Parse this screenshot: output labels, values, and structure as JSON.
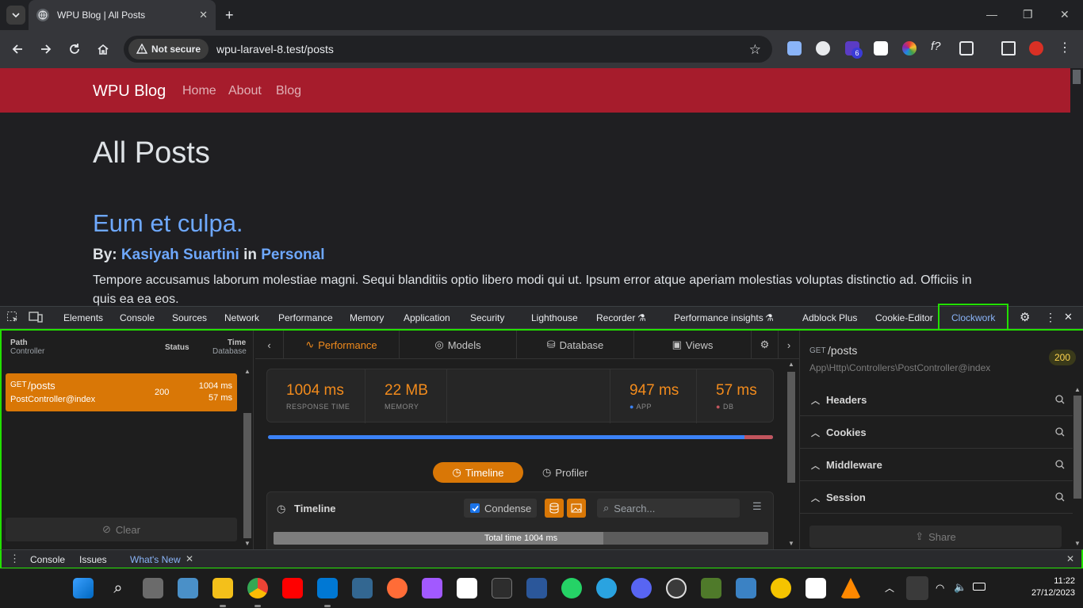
{
  "browser": {
    "tab_title": "WPU Blog | All Posts",
    "tab_close": "✕",
    "new_tab": "+",
    "not_secure": "Not secure",
    "url": "wpu-laravel-8.test/posts",
    "extension_badge": "6"
  },
  "site": {
    "brand": "WPU Blog",
    "nav": [
      "Home",
      "About",
      "Blog"
    ],
    "heading": "All Posts",
    "post": {
      "title": "Eum et culpa.",
      "by": "By:",
      "author": "Kasiyah Suartini",
      "in": "in",
      "category": "Personal",
      "excerpt": "Tempore accusamus laborum molestiae magni. Sequi blanditiis optio libero modi qui ut. Ipsum error atque aperiam molestias voluptas distinctio ad. Officiis in quis ea ea eos."
    }
  },
  "devtools": {
    "tabs": [
      "Elements",
      "Console",
      "Sources",
      "Network",
      "Performance",
      "Memory",
      "Application",
      "Security",
      "Lighthouse",
      "Recorder",
      "Performance insights",
      "Adblock Plus",
      "Cookie-Editor",
      "Clockwork"
    ],
    "active_tab": "Clockwork",
    "drawer_tabs": [
      "Console",
      "Issues",
      "What's New"
    ]
  },
  "clockwork": {
    "list_header": {
      "path": "Path",
      "controller": "Controller",
      "status": "Status",
      "time": "Time",
      "database": "Database"
    },
    "request": {
      "method": "GET",
      "path": "/posts",
      "controller": "PostController@index",
      "status": "200",
      "time": "1004 ms",
      "db_time": "57 ms"
    },
    "clear_label": "Clear",
    "tabs": [
      "Performance",
      "Models",
      "Database",
      "Views"
    ],
    "active_tab": "Performance",
    "stats": {
      "response_time": "1004 ms",
      "response_time_label": "RESPONSE TIME",
      "memory": "22 MB",
      "memory_label": "MEMORY",
      "app": "947 ms",
      "app_label": "APP",
      "db": "57 ms",
      "db_label": "DB"
    },
    "app_db_split": {
      "app_ms": 947,
      "db_ms": 57
    },
    "timeline_btn": "Timeline",
    "profiler_btn": "Profiler",
    "timeline": {
      "title": "Timeline",
      "condense": "Condense",
      "search_placeholder": "Search...",
      "total": "Total time 1004 ms",
      "app_fraction": 0.667
    },
    "detail": {
      "method": "GET",
      "path": "/posts",
      "controller": "App\\Http\\Controllers\\PostController@index",
      "status": "200",
      "sections": [
        "Headers",
        "Cookies",
        "Middleware",
        "Session"
      ],
      "share": "Share"
    }
  },
  "taskbar": {
    "time": "11:22",
    "date": "27/12/2023"
  },
  "colors": {
    "navbar": "#a61c2c",
    "accent": "#d97706",
    "highlight": "#22e000",
    "link": "#6ea8fe"
  }
}
